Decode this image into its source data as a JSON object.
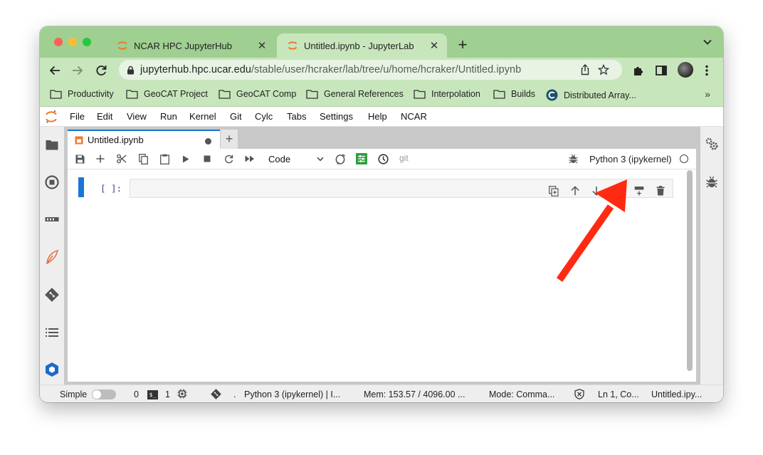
{
  "browser": {
    "tabs": [
      {
        "title": "NCAR HPC JupyterHub",
        "active": false
      },
      {
        "title": "Untitled.ipynb - JupyterLab",
        "active": true
      }
    ],
    "new_tab_label": "+",
    "close_glyph": "✕",
    "address": {
      "host": "jupyterhub.hpc.ucar.edu",
      "path": "/stable/user/hcraker/lab/tree/u/home/hcraker/Untitled.ipynb"
    },
    "bookmarks": [
      {
        "label": "Productivity",
        "icon": "folder-icon"
      },
      {
        "label": "GeoCAT Project",
        "icon": "folder-icon"
      },
      {
        "label": "GeoCAT Comp",
        "icon": "folder-icon"
      },
      {
        "label": "General References",
        "icon": "folder-icon"
      },
      {
        "label": "Interpolation",
        "icon": "folder-icon"
      },
      {
        "label": "Builds",
        "icon": "folder-icon"
      },
      {
        "label": "Distributed Array...",
        "icon": "bookmark-site-icon"
      }
    ],
    "bookmarks_overflow": "»",
    "colors": {
      "frame": "#9fcf91",
      "toolbar": "#c8e6bc"
    }
  },
  "jupyter": {
    "menu": [
      "File",
      "Edit",
      "View",
      "Run",
      "Kernel",
      "Git",
      "Cylc",
      "Tabs",
      "Settings",
      "Help",
      "NCAR"
    ],
    "document_tab": {
      "title": "Untitled.ipynb",
      "add_label": "+"
    },
    "notebook_toolbar": {
      "cell_type": "Code",
      "git_label": "git",
      "kernel_name": "Python 3 (ipykernel)"
    },
    "cell": {
      "prompt": "[ ]:"
    },
    "statusbar": {
      "mode_label": "Simple",
      "terminals_count": "0",
      "terminal_badge": "$_",
      "kernels_count": "1",
      "git_dot": ".",
      "kernel_status": "Python 3 (ipykernel) | I...",
      "memory": "Mem: 153.57 / 4096.00 ...",
      "mode": "Mode: Comma...",
      "position": "Ln 1, Co...",
      "filename": "Untitled.ipy..."
    },
    "colors": {
      "accent": "#1976d2",
      "jupyter_orange": "#f37726",
      "arrow": "#ff2a12"
    }
  }
}
